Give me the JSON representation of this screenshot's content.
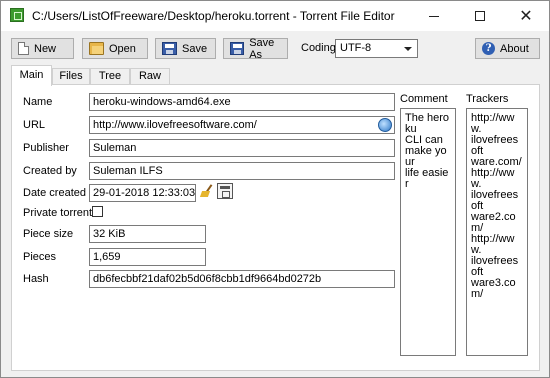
{
  "window": {
    "title": "C:/Users/ListOfFreeware/Desktop/heroku.torrent - Torrent File Editor"
  },
  "toolbar": {
    "new_label": "New",
    "open_label": "Open",
    "save_label": "Save",
    "save_as_label": "Save As",
    "coding_label": "Coding",
    "coding_value": "UTF-8",
    "about_label": "About"
  },
  "tabs": [
    {
      "label": "Main",
      "active": true
    },
    {
      "label": "Files",
      "active": false
    },
    {
      "label": "Tree",
      "active": false
    },
    {
      "label": "Raw",
      "active": false
    }
  ],
  "main": {
    "name_label": "Name",
    "name_value": "heroku-windows-amd64.exe",
    "url_label": "URL",
    "url_value": "http://www.ilovefreesoftware.com/",
    "publisher_label": "Publisher",
    "publisher_value": "Suleman",
    "created_by_label": "Created by",
    "created_by_value": "Suleman ILFS",
    "date_created_label": "Date created",
    "date_created_value": "29-01-2018 12:33:03",
    "private_label": "Private torrent",
    "private_checked": false,
    "piece_size_label": "Piece size",
    "piece_size_value": "32 KiB",
    "pieces_label": "Pieces",
    "pieces_value": "1,659",
    "hash_label": "Hash",
    "hash_value": "db6fecbbf21daf02b5d06f8cbb1df9664bd0272b"
  },
  "comment": {
    "header": "Comment",
    "lines": [
      "The heroku",
      "CLI can",
      "make your",
      "life easier"
    ]
  },
  "trackers": {
    "header": "Trackers",
    "lines": [
      "http://www.",
      "ilovefreesoft",
      "ware.com/",
      "http://www.",
      "ilovefreesoft",
      "ware2.com/",
      "http://www.",
      "ilovefreesoft",
      "ware3.com/"
    ]
  },
  "icons": {
    "new": "new-document-icon",
    "open": "folder-icon",
    "save": "floppy-disk-icon",
    "save_as": "floppy-disk-icon",
    "about": "help-icon",
    "url": "globe-icon",
    "date_clear": "broom-icon",
    "date_pick": "calendar-icon",
    "app": "app-icon"
  }
}
